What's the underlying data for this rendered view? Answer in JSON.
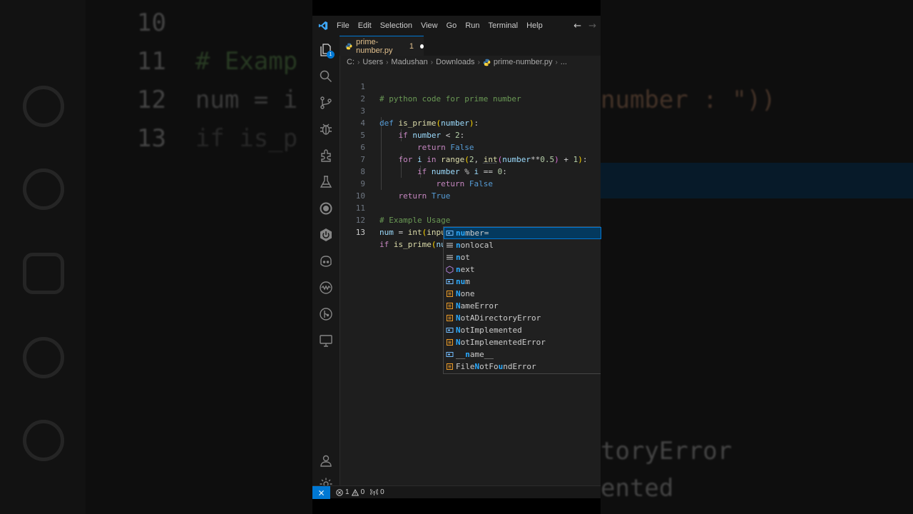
{
  "titlebar": {
    "menu": [
      "File",
      "Edit",
      "Selection",
      "View",
      "Go",
      "Run",
      "Terminal",
      "Help"
    ]
  },
  "activity": {
    "explorer_badge": "1"
  },
  "tab": {
    "filename": "prime-number.py",
    "problems": "1"
  },
  "breadcrumb": [
    "C:",
    "Users",
    "Madushan",
    "Downloads",
    "prime-number.py",
    "..."
  ],
  "editor": {
    "lines": [
      {
        "n": "1",
        "text": "# python code for prime number"
      },
      {
        "n": "2",
        "text": ""
      },
      {
        "n": "3",
        "text": "def is_prime(number):"
      },
      {
        "n": "4",
        "text": "    if number < 2:"
      },
      {
        "n": "5",
        "text": "        return False"
      },
      {
        "n": "6",
        "text": "    for i in range(2, int(number**0.5) + 1):"
      },
      {
        "n": "7",
        "text": "        if number % i == 0:"
      },
      {
        "n": "8",
        "text": "            return False"
      },
      {
        "n": "9",
        "text": "    return True"
      },
      {
        "n": "10",
        "text": ""
      },
      {
        "n": "11",
        "text": "# Example Usage"
      },
      {
        "n": "12",
        "text": "num = int(input(\"Enter a number : \"))"
      },
      {
        "n": "13",
        "text": "if is_prime(nu)"
      }
    ]
  },
  "suggestions": [
    {
      "label": "number=",
      "kind": "variable"
    },
    {
      "label": "nonlocal",
      "kind": "keyword"
    },
    {
      "label": "not",
      "kind": "keyword"
    },
    {
      "label": "next",
      "kind": "method"
    },
    {
      "label": "num",
      "kind": "variable"
    },
    {
      "label": "None",
      "kind": "class"
    },
    {
      "label": "NameError",
      "kind": "class"
    },
    {
      "label": "NotADirectoryError",
      "kind": "class"
    },
    {
      "label": "NotImplemented",
      "kind": "variable"
    },
    {
      "label": "NotImplementedError",
      "kind": "class"
    },
    {
      "label": "__name__",
      "kind": "variable"
    },
    {
      "label": "FileNotFoundError",
      "kind": "class"
    }
  ],
  "statusbar": {
    "errors": "1",
    "warnings": "0",
    "ports": "0"
  },
  "background": {
    "left_lines": [
      {
        "n": "10",
        "text": ""
      },
      {
        "n": "11",
        "text": "# Examp"
      },
      {
        "n": "12",
        "text": "num = i"
      },
      {
        "n": "13",
        "text": "if is_p"
      }
    ],
    "right_lines": [
      "number : \"))",
      "toryError",
      "ented"
    ]
  },
  "colors": {
    "accent": "#0078d4",
    "editor_bg": "#1e1e1e",
    "chrome_bg": "#181818"
  }
}
